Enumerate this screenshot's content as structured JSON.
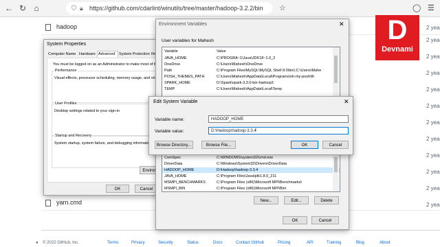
{
  "browser": {
    "url": "https://github.com/cdarlint/winutils/tree/master/hadoop-3.2.2/bin"
  },
  "github": {
    "files": [
      {
        "name": "hadoop"
      },
      {
        "name": "yarn.cmd"
      }
    ],
    "age_label": "2 years",
    "footer": {
      "copyright": "© 2022 GitHub, Inc.",
      "links": [
        "Terms",
        "Privacy",
        "Security",
        "Status",
        "Docs",
        "Contact GitHub",
        "Pricing",
        "API",
        "Training",
        "Blog",
        "About"
      ]
    }
  },
  "logo": {
    "letter": "D",
    "text": "Devnami",
    "color": "#e11b22"
  },
  "system_properties": {
    "title": "System Properties",
    "tabs": [
      "Computer Name",
      "Hardware",
      "Advanced",
      "System Protection",
      "Re"
    ],
    "admin_note": "You must be logged on as an Administrator to make most of the",
    "performance": {
      "label": "Performance",
      "text": "Visual effects, processor scheduling, memory usage, and virtu"
    },
    "user_profiles": {
      "label": "User Profiles",
      "text": "Desktop settings related to your sign-in"
    },
    "startup": {
      "label": "Startup and Recovery",
      "text": "System startup, system failure, and debugging information"
    },
    "env_button": "Environm",
    "ok": "OK",
    "cancel": "Cancel",
    "apply": "A"
  },
  "env_vars": {
    "title": "Environment Variables",
    "user_label": "User variables for Mahesh",
    "col_variable": "Variable",
    "col_value": "Value",
    "user_rows": [
      {
        "name": "JAVA_HOME",
        "value": "C:\\PROGRA~1\\Java\\JDK18~1.0_2"
      },
      {
        "name": "OneDrive",
        "value": "C:\\Users\\Mahesh\\OneDrive"
      },
      {
        "name": "Path",
        "value": "C:\\Program Files\\MySQL\\MySQL Shell 8.0\\bin\\;C:\\Users\\Mahe"
      },
      {
        "name": "POSH_THEMES_PATH",
        "value": "C:\\Users\\Mahesh\\AppData\\Local\\Programs\\oh-my-posh\\th"
      },
      {
        "name": "SPARK_HOME",
        "value": "D:\\Spark\\spark-3.3.0-bin-hadoop3"
      },
      {
        "name": "TEMP",
        "value": "C:\\Users\\Mahesh\\AppData\\Local\\Temp"
      }
    ],
    "system_rows": [
      {
        "name": "ComSpec",
        "value": "C:\\WINDOWS\\system32\\cmd.exe"
      },
      {
        "name": "DriverData",
        "value": "C:\\Windows\\System32\\Drivers\\DriverData"
      },
      {
        "name": "HADOOP_HOME",
        "value": "D:\\Hadoop\\hadoop-3.3.4"
      },
      {
        "name": "JAVA_HOME",
        "value": "C:\\Program Files\\Java\\jdk1.8.0_211"
      },
      {
        "name": "MSMPI_BENCHMARKS",
        "value": "C:\\Program Files (x86)\\Microsoft MPI\\Benchmarks\\"
      },
      {
        "name": "MSMPI_BIN",
        "value": "C:\\Program Files (x86)\\Microsoft MPI\\Bin\\"
      }
    ],
    "new": "New...",
    "edit": "Edit...",
    "delete": "Delete",
    "ok": "OK",
    "cancel": "Cancel"
  },
  "edit_var": {
    "title": "Edit System Variable",
    "name_label": "Variable name:",
    "name_value": "HADOOP_HOME",
    "value_label": "Variable value:",
    "value_value": "D:\\Hadoop\\hadoop-3.3.4",
    "browse_dir": "Browse Directory...",
    "browse_file": "Browse File...",
    "ok": "OK",
    "cancel": "Cancel"
  }
}
